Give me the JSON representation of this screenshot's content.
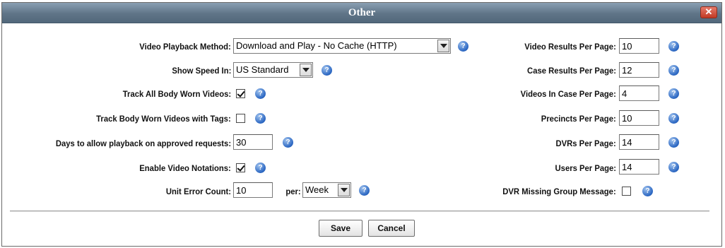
{
  "dialog": {
    "title": "Other",
    "close_label": "✕"
  },
  "left": {
    "video_playback_method": {
      "label": "Video Playback Method:",
      "value": "Download and Play - No Cache (HTTP)"
    },
    "show_speed_in": {
      "label": "Show Speed In:",
      "value": "US Standard"
    },
    "track_all_body_worn": {
      "label": "Track All Body Worn Videos:",
      "checked": true
    },
    "track_body_worn_tags": {
      "label": "Track Body Worn Videos with Tags:",
      "checked": false
    },
    "days_playback": {
      "label": "Days to allow playback on approved requests:",
      "value": "30"
    },
    "enable_video_notations": {
      "label": "Enable Video Notations:",
      "checked": true
    },
    "unit_error_count": {
      "label": "Unit Error Count:",
      "value": "10",
      "per_label": "per:",
      "per_value": "Week"
    }
  },
  "right": {
    "video_results_per_page": {
      "label": "Video Results Per Page:",
      "value": "10"
    },
    "case_results_per_page": {
      "label": "Case Results Per Page:",
      "value": "12"
    },
    "videos_in_case_per_page": {
      "label": "Videos In Case Per Page:",
      "value": "4"
    },
    "precincts_per_page": {
      "label": "Precincts Per Page:",
      "value": "10"
    },
    "dvrs_per_page": {
      "label": "DVRs Per Page:",
      "value": "14"
    },
    "users_per_page": {
      "label": "Users Per Page:",
      "value": "14"
    },
    "dvr_missing_group_message": {
      "label": "DVR Missing Group Message:",
      "checked": false
    }
  },
  "buttons": {
    "save": "Save",
    "cancel": "Cancel"
  }
}
